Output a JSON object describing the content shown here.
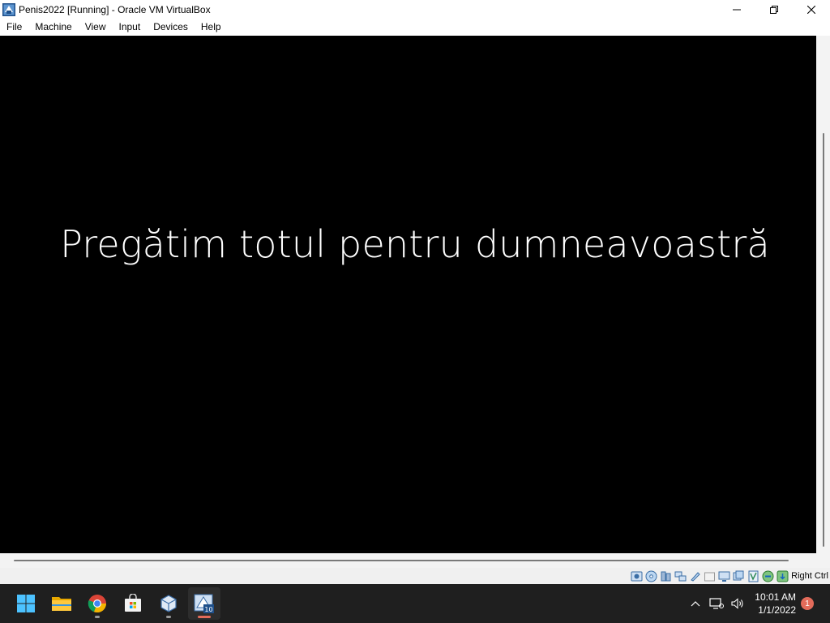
{
  "window": {
    "title": "Penis2022 [Running] - Oracle VM VirtualBox",
    "app_icon": "virtualbox-icon"
  },
  "menu": {
    "items": [
      "File",
      "Machine",
      "View",
      "Input",
      "Devices",
      "Help"
    ]
  },
  "vm": {
    "message": "Pregătim totul pentru dumneavoastră",
    "background": "#000000"
  },
  "statusbar": {
    "icons": [
      "hard-disk-icon",
      "optical-drive-icon",
      "audio-icon",
      "network-icon",
      "usb-icon",
      "shared-folders-icon",
      "display-icon",
      "video-capture-icon",
      "cpu-icon",
      "mouse-integration-icon",
      "keyboard-icon"
    ],
    "host_key": "Right Ctrl"
  },
  "taskbar": {
    "apps": [
      "start-icon",
      "file-explorer-icon",
      "chrome-icon",
      "microsoft-store-icon",
      "virtualbox-icon",
      "virtualbox-vm-icon"
    ],
    "active_app": "virtualbox-vm-icon",
    "accent": "#e36b5a"
  },
  "tray": {
    "time": "10:01 AM",
    "date": "1/1/2022",
    "notification_count": "1"
  }
}
